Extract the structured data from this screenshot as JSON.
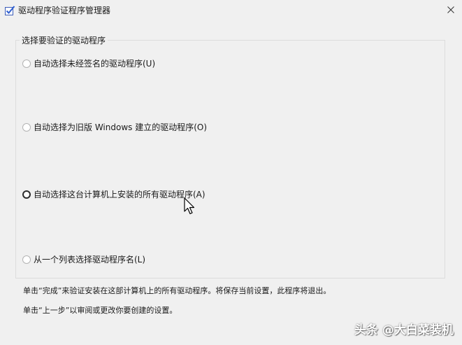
{
  "window": {
    "title": "驱动程序验证程序管理器",
    "app_icon": "checkbox-app-icon",
    "close_icon": "close-icon"
  },
  "group": {
    "legend": "选择要验证的驱动程序"
  },
  "options": [
    {
      "label": "自动选择未经签名的驱动程序(U)",
      "selected": false
    },
    {
      "label": "自动选择为旧版 Windows 建立的驱动程序(O)",
      "selected": false
    },
    {
      "label": "自动选择这台计算机上安装的所有驱动程序(A)",
      "selected": false,
      "focused": true
    },
    {
      "label": "从一个列表选择驱动程序名(L)",
      "selected": false
    }
  ],
  "info": {
    "line1": "单击“完成”来验证安装在这部计算机上的所有驱动程序。将保存当前设置，此程序将退出。",
    "line2": "单击“上一步”以审阅或更改你要创建的设置。"
  },
  "watermark": "头条 @大白菜装机",
  "colors": {
    "window_bg": "#f0f0f0",
    "group_border": "#dcdcdc",
    "text": "#1a1a1a",
    "icon_blue": "#2f5fd0"
  }
}
